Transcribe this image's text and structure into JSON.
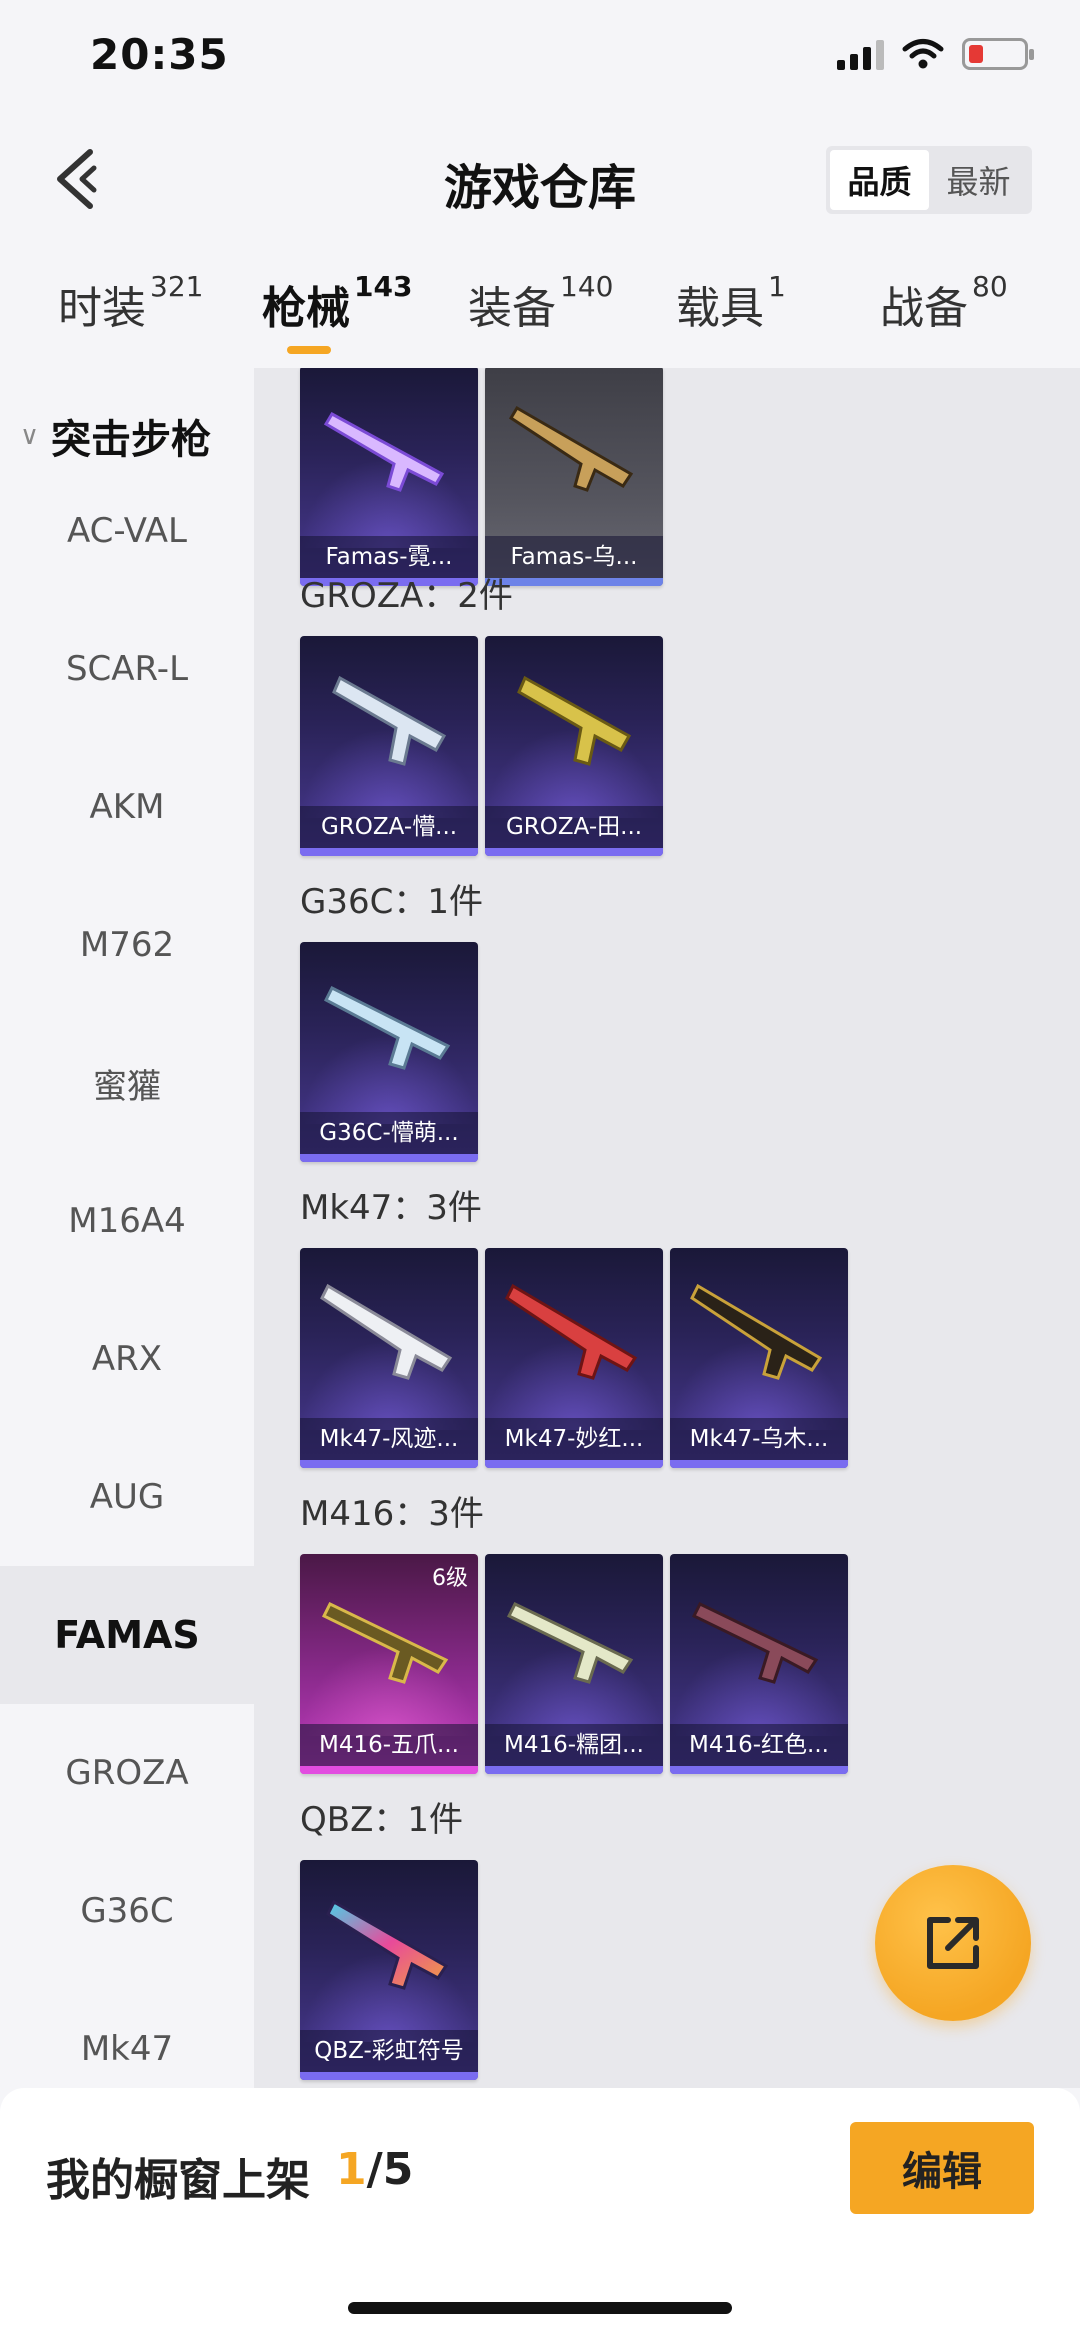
{
  "status": {
    "time": "20:35"
  },
  "header": {
    "title": "游戏仓库",
    "sort": [
      {
        "label": "品质",
        "active": true
      },
      {
        "label": "最新",
        "active": false
      }
    ]
  },
  "tabs": [
    {
      "label": "时装",
      "count": "321"
    },
    {
      "label": "枪械",
      "count": "143"
    },
    {
      "label": "装备",
      "count": "140"
    },
    {
      "label": "载具",
      "count": "1"
    },
    {
      "label": "战备",
      "count": "80"
    }
  ],
  "sidebar": {
    "group": "突击步枪",
    "items": [
      "AC-VAL",
      "SCAR-L",
      "AKM",
      "M762",
      "蜜獾",
      "M16A4",
      "ARX",
      "AUG",
      "FAMAS",
      "GROZA",
      "G36C",
      "Mk47"
    ],
    "active": "FAMAS"
  },
  "content": {
    "top_cards": [
      {
        "name": "Famas-霓..."
      },
      {
        "name": "Famas-乌..."
      }
    ],
    "sections": [
      {
        "title": "GROZA：2件",
        "cards": [
          {
            "name": "GROZA-懵..."
          },
          {
            "name": "GROZA-田..."
          }
        ]
      },
      {
        "title": "G36C：1件",
        "cards": [
          {
            "name": "G36C-懵萌..."
          }
        ]
      },
      {
        "title": "Mk47：3件",
        "cards": [
          {
            "name": "Mk47-风迹..."
          },
          {
            "name": "Mk47-妙红..."
          },
          {
            "name": "Mk47-乌木..."
          }
        ]
      },
      {
        "title": "M416：3件",
        "cards": [
          {
            "name": "M416-五爪...",
            "level": "6级"
          },
          {
            "name": "M416-糯团..."
          },
          {
            "name": "M416-红色..."
          }
        ]
      },
      {
        "title": "QBZ：1件",
        "cards": [
          {
            "name": "QBZ-彩虹符号"
          }
        ]
      }
    ]
  },
  "bottom": {
    "label": "我的橱窗上架",
    "current": "1",
    "total": "/5",
    "edit": "编辑"
  },
  "colors": {
    "accent": "#f5a623",
    "card_blue": "#4a3a94",
    "card_pink": "#c23dc0"
  },
  "icons": {
    "back": "chevron-left-icon",
    "share": "external-link-icon"
  }
}
